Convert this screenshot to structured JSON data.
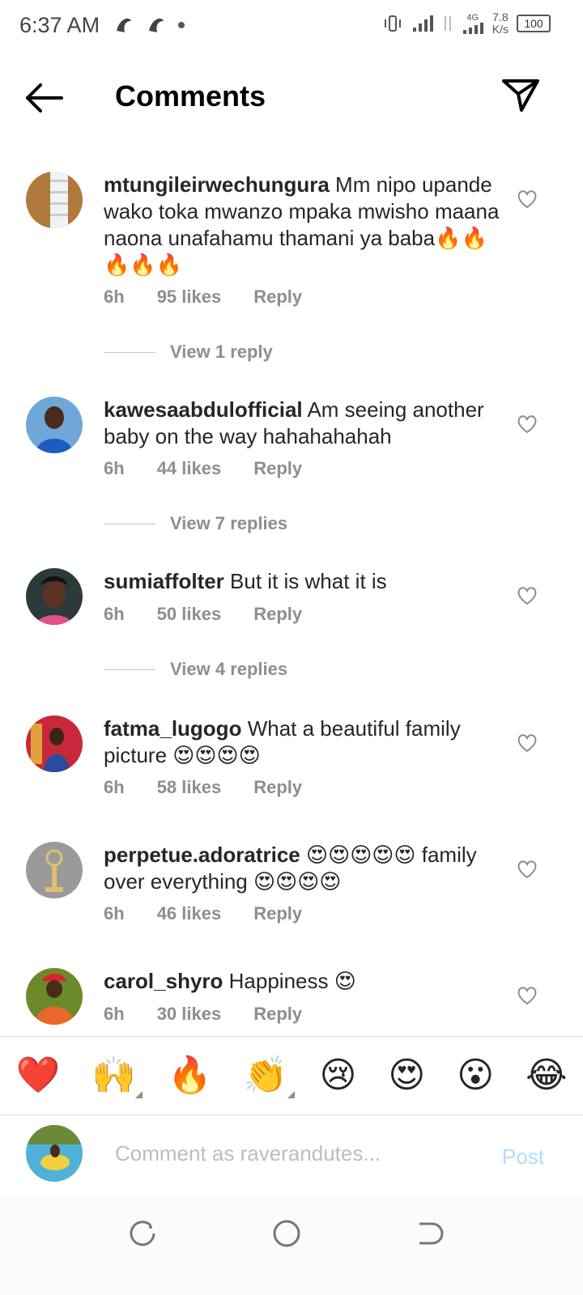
{
  "status": {
    "time": "6:37 AM",
    "network": "4G",
    "speed": "7.8",
    "speed_unit": "K/s",
    "battery": "100"
  },
  "header": {
    "title": "Comments",
    "back_icon": "arrow-left-icon",
    "send_icon": "paper-plane-icon"
  },
  "comments": [
    {
      "username": "mtungileirwechungura",
      "text": "Mm nipo upande wako toka mwanzo mpaka mwisho maana naona unafahamu thamani ya baba🔥🔥🔥🔥🔥",
      "time": "6h",
      "likes": "95 likes",
      "reply": "Reply",
      "view_replies": "View 1 reply"
    },
    {
      "username": "kawesaabdulofficial",
      "text": "Am seeing another baby on the way hahahahahah",
      "time": "6h",
      "likes": "44 likes",
      "reply": "Reply",
      "view_replies": "View 7 replies"
    },
    {
      "username": "sumiaffolter",
      "text": "But it is what it is",
      "time": "6h",
      "likes": "50 likes",
      "reply": "Reply",
      "view_replies": "View 4 replies"
    },
    {
      "username": "fatma_lugogo",
      "text": "What a beautiful family picture 😍😍😍😍",
      "time": "6h",
      "likes": "58 likes",
      "reply": "Reply"
    },
    {
      "username": "perpetue.adoratrice",
      "text": "😍😍😍😍😍 family over everything 😍😍😍😍",
      "time": "6h",
      "likes": "46 likes",
      "reply": "Reply"
    },
    {
      "username": "carol_shyro",
      "text": "Happiness 😍",
      "time": "6h",
      "likes": "30 likes",
      "reply": "Reply"
    }
  ],
  "emoji_bar": [
    "❤️",
    "🙌",
    "🔥",
    "👏",
    "😢",
    "😍",
    "😮",
    "😂"
  ],
  "input": {
    "placeholder": "Comment as raverandutes...",
    "post_label": "Post"
  },
  "colors": {
    "text": "#262626",
    "secondary": "#8e8e8e",
    "post_disabled": "#b3dbff"
  }
}
